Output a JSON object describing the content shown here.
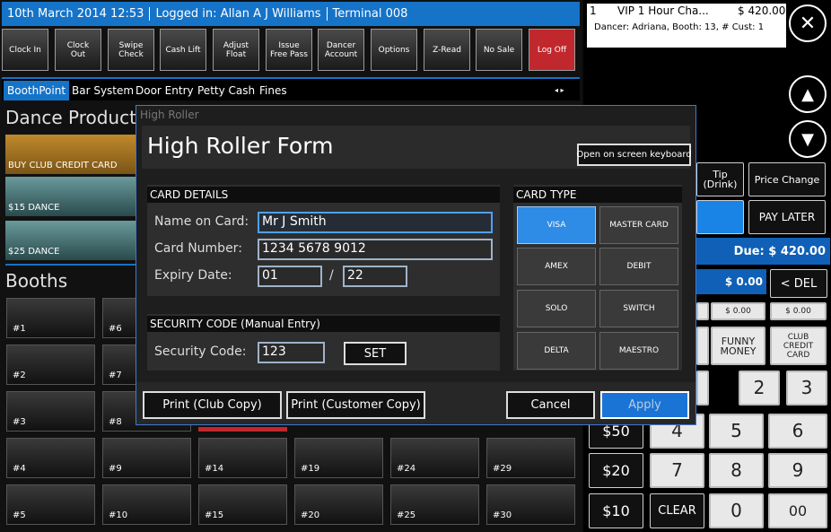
{
  "status": {
    "datetime": "10th March 2014 12:53",
    "login": "Logged in: Allan A J Williams",
    "terminal": "Terminal 008"
  },
  "toolbar": [
    "Clock In",
    "Clock\nOut",
    "Swipe\nCheck",
    "Cash Lift",
    "Adjust\nFloat",
    "Issue\nFree Pass",
    "Dancer\nAccount",
    "Options",
    "Z-Read",
    "No Sale",
    "Log Off"
  ],
  "tabs": [
    "BoothPoint",
    "Bar System",
    "Door Entry",
    "Petty Cash",
    "Fines"
  ],
  "tab_arrows": "◂ ▸",
  "products": {
    "heading": "Dance Products",
    "items": [
      "BUY CLUB CREDIT CARD",
      "$15 DANCE",
      "$25 DANCE"
    ]
  },
  "booths": {
    "heading": "Booths",
    "visible_labels": [
      "#1",
      "#6",
      "#2",
      "#7",
      "#3",
      "#8",
      "#4",
      "#9",
      "#14",
      "#19",
      "#24",
      "#29",
      "#5",
      "#10",
      "#15",
      "#20",
      "#25",
      "#30"
    ]
  },
  "order": {
    "qty": "1",
    "item": "VIP 1 Hour Cha...",
    "price": "$ 420.00",
    "detail": "Dancer: Adriana, Booth: 13, # Cust: 1"
  },
  "right": {
    "tip": "Tip (Drink)",
    "price_change": "Price Change",
    "pay_later": "PAY LATER",
    "due": "Due: $ 420.00",
    "amount": "$ 0.00",
    "del": "< DEL",
    "small_amounts": [
      "$ 0.00",
      "$ 0.00"
    ],
    "funny_money": "FUNNY\nMONEY",
    "club_credit": "CLUB\nCREDIT\nCARD",
    "denoms": [
      "$50",
      "$20",
      "$10"
    ],
    "keys": [
      "2",
      "3",
      "4",
      "5",
      "6",
      "7",
      "8",
      "9",
      "CLEAR",
      "0",
      "00"
    ]
  },
  "dialog": {
    "window_title": "High Roller",
    "title": "High Roller Form",
    "keyboard_button": "Open on screen keyboard",
    "card_details": {
      "heading": "CARD DETAILS",
      "name_label": "Name on Card:",
      "name_value": "Mr J Smith",
      "number_label": "Card Number:",
      "number_value": "1234 5678 9012",
      "expiry_label": "Expiry Date:",
      "expiry_month": "01",
      "expiry_sep": "/",
      "expiry_year": "22"
    },
    "security": {
      "heading": "SECURITY CODE (Manual Entry)",
      "label": "Security Code:",
      "value": "123",
      "set": "SET"
    },
    "card_type": {
      "heading": "CARD TYPE",
      "options": [
        "VISA",
        "MASTER CARD",
        "AMEX",
        "DEBIT",
        "SOLO",
        "SWITCH",
        "DELTA",
        "MAESTRO"
      ],
      "selected": "VISA"
    },
    "buttons": {
      "print_club": "Print (Club Copy)",
      "print_customer": "Print (Customer Copy)",
      "cancel": "Cancel",
      "apply": "Apply"
    }
  },
  "colors": {
    "accent": "#1573c8",
    "logoff": "#c0282d",
    "product_gold": "#a8761f",
    "product_teal": "#4a7f82"
  }
}
